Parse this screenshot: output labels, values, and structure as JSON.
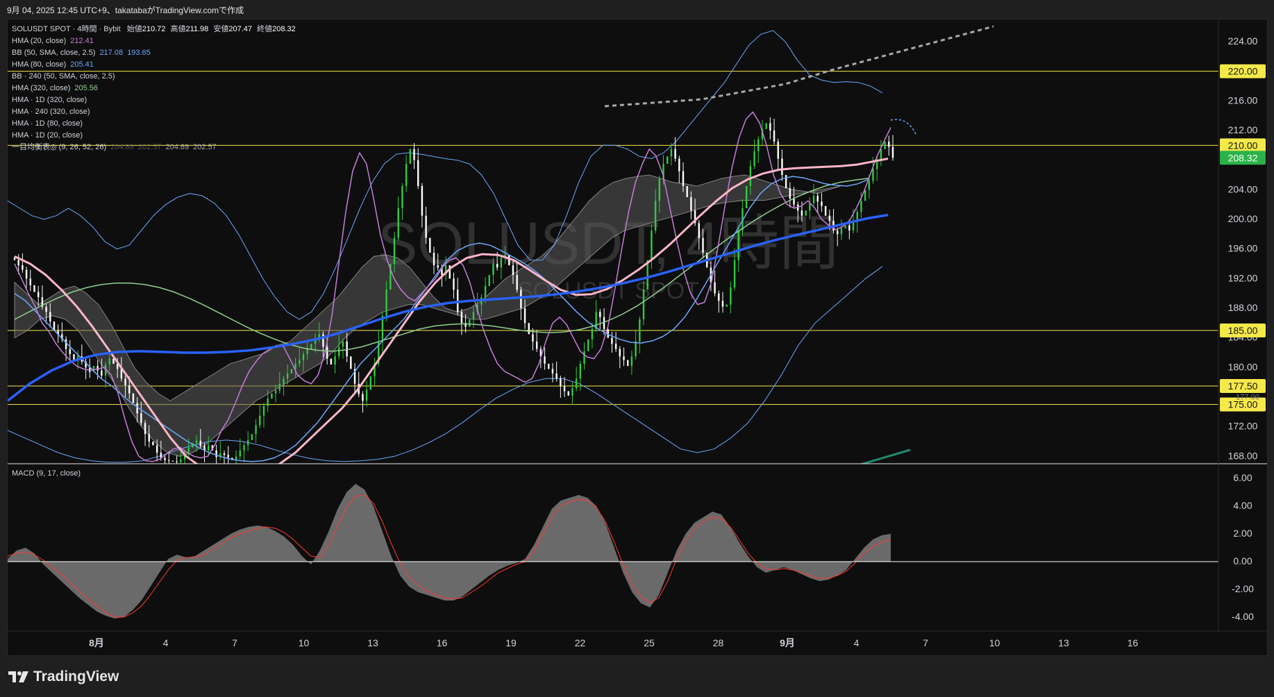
{
  "header": {
    "attribution": "9月 04, 2025 12:45 UTC+9、takatabaがTradingView.comで作成"
  },
  "legend": {
    "title_prefix": "SOLUSDT SPOT · 4時間 · Bybit",
    "open_label": "始値",
    "open": "210.72",
    "high_label": "高値",
    "high": "211.98",
    "low_label": "安値",
    "low": "207.47",
    "close_label": "終値",
    "close": "208.32",
    "hma20": "HMA (20, close)",
    "hma20_val": "212.41",
    "bb": "BB (50, SMA, close, 2.5)",
    "bb_upper": "217.08",
    "bb_lower": "193.65",
    "hma80": "HMA (80, close)",
    "hma80_val": "205.41",
    "bb240": "BB · 240 (50, SMA, close, 2.5)",
    "hma320": "HMA (320, close)",
    "hma320_val": "205.56",
    "hma1d320": "HMA · 1D (320, close)",
    "hma240_320": "HMA · 240 (320, close)",
    "hma1d80": "HMA · 1D (80, close)",
    "hma1d20": "HMA · 1D (20, close)",
    "ichimoku": "一目均衡表◎ (9, 26, 52, 26)",
    "ichi_v1": "204.89",
    "ichi_v2": "202.57",
    "ichi_v3": "204.89",
    "ichi_v4": "202.57",
    "macd": "MACD (9, 17, close)"
  },
  "watermark": {
    "symbol": "SOLUSDT, 4時間",
    "sub": "SOLUSDT SPOT"
  },
  "brand": "TradingView",
  "colors": {
    "up": "#2ecc40",
    "down": "#ffffff",
    "hma20": "#c77ddb",
    "hma80": "#6aa9ff",
    "hma320_green": "#8fd18f",
    "pink": "#ffb6c8",
    "blue_thick": "#2962ff",
    "level": "#f5e94a",
    "cloud": "#5a5a5a",
    "macd_area": "#7a7a7a",
    "signal": "#ff3b30"
  },
  "chart_data": {
    "type": "candlestick",
    "x_tick_labels": [
      "8月",
      "4",
      "7",
      "10",
      "13",
      "16",
      "19",
      "22",
      "25",
      "28",
      "9月",
      "4",
      "7",
      "10",
      "13",
      "16"
    ],
    "ylim": [
      167,
      227
    ],
    "y_ticks": [
      "224.00",
      "216.00",
      "212.00",
      "204.00",
      "200.00",
      "196.00",
      "192.00",
      "188.00",
      "184.00",
      "180.00",
      "172.00",
      "168.00"
    ],
    "horizontal_levels": [
      220.0,
      210.0,
      185.0,
      177.5,
      175.0
    ],
    "level_labels": [
      "220.00",
      "210.00",
      "185.00",
      "177.50",
      "175.00"
    ],
    "last_price": 208.32,
    "last_price_label": "208.32",
    "last_close_green": "208.32",
    "hidden_tick": "177.00",
    "bars_per_day": 6,
    "candles_close": [
      194.5,
      193.8,
      193.2,
      192.0,
      191.1,
      190.2,
      189.5,
      188.2,
      187.5,
      186.2,
      185.0,
      184.5,
      183.8,
      182.5,
      181.8,
      181.0,
      181.5,
      180.8,
      180.0,
      179.4,
      180.2,
      179.6,
      178.9,
      180.4,
      181.2,
      180.5,
      179.8,
      178.5,
      177.6,
      176.5,
      175.2,
      173.8,
      172.5,
      171.0,
      170.0,
      169.5,
      168.5,
      167.8,
      167.5,
      167.4,
      167.3,
      167.2,
      167.6,
      168.5,
      169.2,
      169.8,
      170.1,
      169.4,
      168.8,
      169.5,
      168.8,
      167.9,
      168.4,
      168.2,
      167.8,
      167.5,
      168.0,
      168.8,
      169.5,
      170.2,
      171.0,
      172.2,
      173.5,
      174.8,
      175.8,
      176.5,
      176.9,
      177.8,
      178.5,
      179.2,
      179.8,
      180.5,
      181.0,
      181.8,
      182.5,
      183.2,
      183.8,
      184.5,
      182.8,
      181.2,
      180.4,
      181.5,
      182.8,
      183.5,
      181.5,
      179.8,
      177.8,
      176.4,
      175.5,
      177.0,
      178.8,
      180.5,
      183.5,
      187.0,
      190.5,
      194.0,
      197.5,
      201.5,
      204.5,
      207.5,
      209.5,
      208.0,
      204.5,
      200.5,
      197.5,
      195.5,
      193.8,
      193.5,
      192.5,
      193.8,
      192.0,
      190.5,
      187.5,
      186.0,
      185.5,
      186.5,
      187.5,
      188.5,
      189.5,
      191.0,
      192.5,
      194.0,
      193.5,
      194.8,
      195.2,
      193.8,
      192.5,
      190.5,
      188.0,
      186.0,
      184.5,
      183.5,
      182.5,
      181.5,
      180.5,
      179.8,
      179.2,
      178.5,
      177.5,
      176.8,
      176.2,
      177.2,
      178.5,
      180.5,
      182.2,
      183.8,
      185.2,
      187.5,
      186.8,
      185.2,
      184.0,
      183.2,
      182.5,
      181.5,
      181.0,
      180.2,
      181.5,
      183.5,
      186.5,
      190.5,
      194.5,
      198.5,
      202.5,
      205.5,
      207.5,
      208.5,
      209.5,
      208.2,
      206.5,
      204.5,
      203.0,
      201.2,
      199.5,
      197.5,
      195.5,
      193.5,
      191.5,
      190.0,
      189.0,
      188.2,
      188.5,
      190.8,
      194.5,
      198.5,
      201.5,
      204.5,
      207.2,
      209.2,
      210.8,
      212.2,
      213.0,
      212.0,
      210.5,
      208.2,
      206.0,
      204.2,
      202.8,
      202.0,
      201.2,
      200.5,
      201.2,
      202.2,
      203.2,
      202.4,
      201.8,
      200.5,
      199.8,
      198.5,
      198.0,
      198.8,
      199.2,
      198.5,
      199.8,
      201.0,
      202.5,
      204.0,
      205.2,
      206.8,
      208.0,
      209.5,
      210.5,
      209.8,
      208.32
    ],
    "candle_spread": 1.6,
    "hma20_series": [
      194.0,
      192.0,
      190.0,
      188.2,
      186.0,
      184.8,
      183.2,
      182.0,
      181.0,
      180.2,
      179.8,
      179.6,
      179.8,
      180.0,
      179.0,
      176.5,
      173.0,
      170.0,
      168.0,
      167.4,
      167.3,
      167.6,
      168.3,
      169.0,
      169.2,
      168.5,
      168.0,
      167.8,
      168.0,
      169.5,
      171.5,
      173.0,
      175.2,
      177.5,
      179.5,
      180.8,
      181.9,
      182.5,
      183.0,
      182.8,
      181.0,
      179.0,
      178.2,
      177.8,
      179.0,
      182.0,
      187.0,
      194.0,
      201.0,
      206.5,
      209.0,
      207.5,
      203.0,
      198.0,
      194.5,
      192.0,
      190.5,
      189.5,
      189.0,
      190.0,
      191.0,
      192.0,
      193.5,
      194.5,
      194.8,
      193.8,
      191.5,
      188.0,
      185.0,
      182.5,
      180.5,
      179.5,
      179.0,
      178.5,
      178.0,
      178.5,
      180.5,
      183.5,
      186.0,
      186.8,
      185.8,
      184.0,
      182.2,
      181.4,
      181.2,
      182.5,
      185.5,
      190.5,
      196.0,
      201.0,
      205.0,
      207.5,
      209.5,
      208.5,
      206.0,
      201.5,
      197.0,
      193.0,
      190.0,
      188.5,
      188.8,
      191.5,
      196.5,
      202.0,
      207.0,
      211.0,
      213.5,
      214.5,
      213.0,
      210.0,
      206.0,
      203.5,
      202.0,
      201.5,
      201.8,
      202.5,
      201.5,
      200.0,
      199.2,
      198.6,
      199.0,
      199.8,
      201.5,
      203.5,
      206.0,
      208.5,
      210.5,
      212.41
    ],
    "hma80_series": [
      190.0,
      189.0,
      187.5,
      186.0,
      184.5,
      183.0,
      181.5,
      180.0,
      178.5,
      177.5,
      176.2,
      175.0,
      174.0,
      173.0,
      172.0,
      171.0,
      170.0,
      169.2,
      168.5,
      168.0,
      167.6,
      167.4,
      167.3,
      167.4,
      167.8,
      168.5,
      169.5,
      171.0,
      172.5,
      174.5,
      176.5,
      178.5,
      180.5,
      182.0,
      183.5,
      185.0,
      186.5,
      188.5,
      190.5,
      192.5,
      194.5,
      195.8,
      196.5,
      196.8,
      196.5,
      195.8,
      195.0,
      194.2,
      193.2,
      192.0,
      190.5,
      189.0,
      187.5,
      186.2,
      185.2,
      184.4,
      183.8,
      183.4,
      183.3,
      183.6,
      184.2,
      185.2,
      186.8,
      189.0,
      191.5,
      194.0,
      196.5,
      199.0,
      201.5,
      203.5,
      204.8,
      205.5,
      205.8,
      205.6,
      205.2,
      204.8,
      204.6,
      204.5,
      204.8,
      205.41
    ],
    "hma320_green_series": [
      186.5,
      187.5,
      188.5,
      189.4,
      190.2,
      190.8,
      191.2,
      191.4,
      191.4,
      191.2,
      190.8,
      190.2,
      189.4,
      188.5,
      187.5,
      186.5,
      185.5,
      184.6,
      183.8,
      183.1,
      182.6,
      182.3,
      182.2,
      182.4,
      182.8,
      183.4,
      184.0,
      184.6,
      185.2,
      185.6,
      185.8,
      185.9,
      185.8,
      185.6,
      185.3,
      185.0,
      184.8,
      184.7,
      184.8,
      185.1,
      185.6,
      186.3,
      187.2,
      188.3,
      189.6,
      191.0,
      192.5,
      194.0,
      195.5,
      197.0,
      198.4,
      199.7,
      200.9,
      202.0,
      203.0,
      203.8,
      204.5,
      205.0,
      205.3,
      205.56
    ],
    "pink_series": [
      195.0,
      194.0,
      192.5,
      190.5,
      188.2,
      185.5,
      182.5,
      179.5,
      176.5,
      173.5,
      170.5,
      168.0,
      166.5,
      165.5,
      165.2,
      165.4,
      166.0,
      167.0,
      168.5,
      170.5,
      172.5,
      174.5,
      177.0,
      180.0,
      183.0,
      186.0,
      189.0,
      191.5,
      193.5,
      194.8,
      195.3,
      195.2,
      194.5,
      193.2,
      191.8,
      190.5,
      189.8,
      189.9,
      190.6,
      191.8,
      193.2,
      194.8,
      196.6,
      198.6,
      200.6,
      202.5,
      204.2,
      205.4,
      206.2,
      206.7,
      206.9,
      207.0,
      207.1,
      207.2,
      207.4,
      207.8,
      208.2
    ],
    "blue_thick_series": [
      175.5,
      177.8,
      179.6,
      180.9,
      181.7,
      182.1,
      182.2,
      182.1,
      182.0,
      182.0,
      182.1,
      182.3,
      182.7,
      183.2,
      183.8,
      184.6,
      185.6,
      186.6,
      187.5,
      188.2,
      188.7,
      189.0,
      189.2,
      189.4,
      189.6,
      189.9,
      190.3,
      190.8,
      191.4,
      192.1,
      192.9,
      193.8,
      194.7,
      195.6,
      196.5,
      197.3,
      198.0,
      198.7,
      199.4,
      200.1,
      200.6
    ],
    "cloud_upper": [
      191.5,
      190.0,
      188.5,
      189.5,
      190.5,
      191.0,
      190.0,
      188.5,
      186.0,
      183.0,
      180.0,
      178.0,
      176.5,
      175.5,
      176.5,
      177.5,
      178.5,
      179.5,
      180.5,
      181.0,
      181.5,
      182.0,
      183.0,
      183.5,
      185.0,
      186.5,
      188.0,
      189.5,
      191.5,
      193.5,
      195.0,
      195.2,
      194.8,
      193.5,
      191.5,
      189.5,
      188.0,
      187.5,
      188.0,
      189.0,
      190.5,
      192.0,
      193.0,
      194.0,
      195.0,
      196.5,
      198.5,
      200.5,
      202.5,
      204.0,
      205.0,
      205.5,
      205.8,
      206.0,
      205.5,
      205.0,
      204.8,
      204.5,
      205.0,
      205.5,
      205.8,
      206.0,
      205.5,
      205.0,
      204.5,
      204.0,
      203.8,
      203.5,
      204.0,
      204.5
    ],
    "cloud_lower": [
      184.0,
      185.0,
      186.5,
      187.0,
      186.5,
      185.0,
      182.5,
      180.0,
      177.5,
      174.5,
      172.0,
      170.0,
      168.5,
      168.0,
      168.5,
      169.5,
      171.0,
      172.5,
      174.0,
      175.5,
      176.5,
      177.5,
      178.5,
      179.5,
      180.5,
      182.0,
      184.0,
      185.5,
      186.5,
      187.5,
      188.0,
      188.5,
      188.5,
      188.0,
      187.5,
      187.0,
      186.5,
      186.5,
      187.0,
      187.5,
      188.0,
      189.0,
      190.0,
      191.5,
      193.0,
      194.5,
      196.0,
      197.5,
      198.5,
      199.0,
      199.5,
      200.0,
      200.5,
      201.0,
      201.5,
      202.0,
      202.3,
      202.5,
      202.6,
      202.57
    ],
    "bb_upper_series": [
      202.5,
      201.5,
      200.5,
      200.0,
      200.5,
      201.5,
      200.5,
      199.0,
      197.0,
      196.0,
      196.5,
      198.5,
      200.5,
      202.0,
      203.0,
      203.5,
      203.2,
      202.2,
      200.5,
      198.0,
      195.0,
      192.0,
      189.5,
      187.5,
      186.5,
      187.5,
      190.0,
      193.5,
      197.5,
      201.5,
      205.0,
      207.5,
      208.8,
      209.0,
      208.8,
      208.5,
      208.2,
      208.0,
      207.5,
      206.0,
      203.5,
      200.0,
      196.5,
      194.5,
      194.5,
      196.5,
      200.5,
      205.0,
      208.5,
      210.0,
      210.0,
      209.5,
      208.5,
      208.2,
      209.0,
      210.5,
      212.5,
      214.5,
      216.5,
      218.5,
      221.0,
      223.5,
      225.0,
      225.5,
      224.0,
      221.5,
      219.5,
      218.8,
      218.5,
      218.6,
      218.5,
      218.0,
      217.08
    ],
    "bb_lower_series": [
      171.5,
      170.5,
      169.5,
      168.5,
      167.8,
      167.4,
      167.2,
      167.2,
      167.4,
      168.0,
      168.8,
      169.5,
      170.0,
      170.2,
      170.0,
      169.5,
      168.8,
      168.2,
      167.7,
      167.4,
      167.3,
      167.4,
      167.6,
      168.0,
      168.8,
      169.8,
      171.0,
      172.5,
      174.2,
      175.8,
      177.0,
      178.0,
      178.5,
      178.5,
      177.8,
      176.5,
      175.0,
      173.5,
      172.0,
      170.5,
      169.0,
      168.5,
      169.0,
      170.5,
      172.5,
      175.5,
      179.0,
      183.0,
      186.0,
      188.0,
      190.0,
      192.0,
      193.65
    ],
    "macd_series": [
      0.2,
      0.8,
      1.0,
      0.6,
      -0.2,
      -0.8,
      -1.4,
      -2.0,
      -2.6,
      -3.1,
      -3.6,
      -3.9,
      -4.1,
      -4.0,
      -3.5,
      -2.8,
      -1.8,
      -0.8,
      0.2,
      0.5,
      0.3,
      0.4,
      0.8,
      1.2,
      1.6,
      2.0,
      2.3,
      2.5,
      2.6,
      2.5,
      2.2,
      1.8,
      1.2,
      0.4,
      -0.2,
      0.8,
      2.2,
      3.8,
      5.0,
      5.6,
      5.2,
      4.0,
      2.2,
      0.4,
      -1.0,
      -1.8,
      -2.2,
      -2.4,
      -2.6,
      -2.8,
      -2.8,
      -2.5,
      -2.0,
      -1.5,
      -1.0,
      -0.6,
      -0.3,
      -0.1,
      0.2,
      1.2,
      2.5,
      3.8,
      4.4,
      4.6,
      4.8,
      4.6,
      4.0,
      2.8,
      1.0,
      -0.8,
      -2.2,
      -3.0,
      -3.3,
      -2.4,
      -0.8,
      0.8,
      2.0,
      2.8,
      3.2,
      3.6,
      3.4,
      2.5,
      1.4,
      0.4,
      -0.4,
      -0.8,
      -0.6,
      -0.4,
      -0.6,
      -0.9,
      -1.2,
      -1.4,
      -1.3,
      -1.0,
      -0.6,
      0.2,
      1.0,
      1.6,
      1.9,
      2.0
    ],
    "macd_signal_series": [
      0.4,
      0.6,
      0.7,
      0.5,
      0.1,
      -0.4,
      -0.9,
      -1.5,
      -2.1,
      -2.7,
      -3.2,
      -3.7,
      -4.0,
      -4.0,
      -3.7,
      -3.2,
      -2.4,
      -1.5,
      -0.6,
      0.1,
      0.3,
      0.3,
      0.5,
      0.9,
      1.3,
      1.7,
      2.0,
      2.2,
      2.4,
      2.5,
      2.4,
      2.1,
      1.6,
      1.0,
      0.4,
      0.3,
      1.2,
      2.6,
      3.9,
      4.7,
      4.8,
      4.2,
      2.9,
      1.3,
      -0.1,
      -1.1,
      -1.7,
      -2.1,
      -2.4,
      -2.6,
      -2.7,
      -2.6,
      -2.2,
      -1.8,
      -1.3,
      -0.8,
      -0.5,
      -0.2,
      0.0,
      0.8,
      2.0,
      3.2,
      4.0,
      4.3,
      4.5,
      4.4,
      3.9,
      2.9,
      1.4,
      -0.2,
      -1.6,
      -2.5,
      -3.0,
      -2.6,
      -1.4,
      0.2,
      1.5,
      2.4,
      2.9,
      3.2,
      3.1,
      2.5,
      1.6,
      0.6,
      -0.1,
      -0.5,
      -0.6,
      -0.5,
      -0.6,
      -0.8,
      -1.0,
      -1.2,
      -1.2,
      -1.0,
      -0.7,
      -0.1,
      0.6,
      1.1,
      1.4,
      1.6
    ],
    "macd_ylim": [
      -5,
      7
    ],
    "macd_ticks": [
      "6.00",
      "4.00",
      "2.00",
      "0.00",
      "-2.00",
      "-4.00"
    ]
  }
}
